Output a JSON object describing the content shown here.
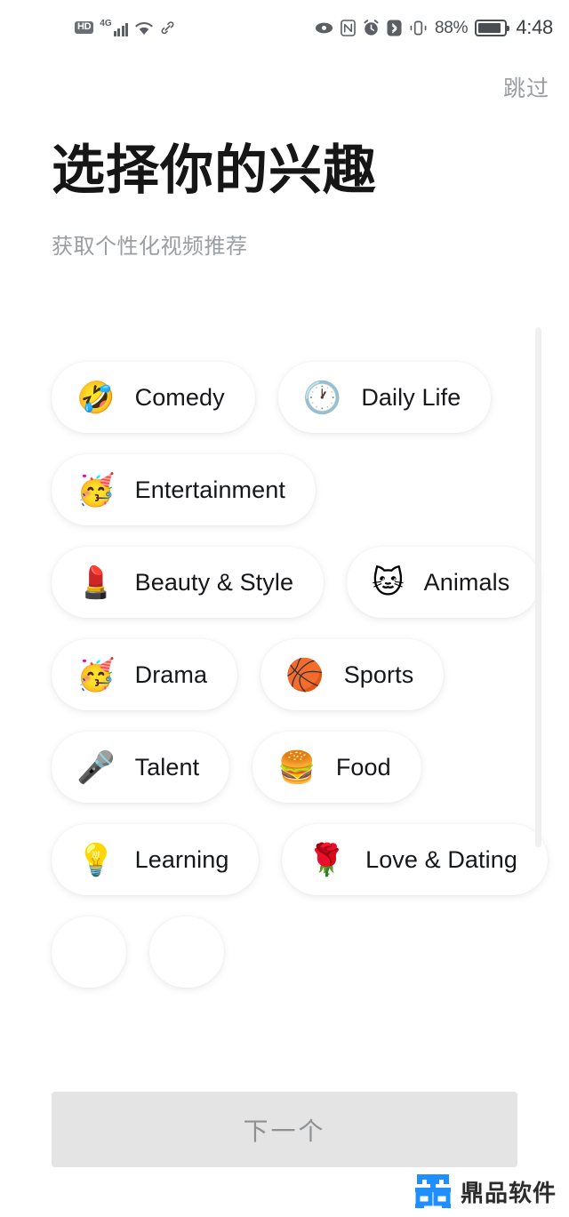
{
  "status_bar": {
    "hd_label": "HD",
    "network_label": "4G",
    "icons": [
      "hd-badge-icon",
      "signal-bars-icon",
      "wifi-icon",
      "link-icon",
      "eye-icon",
      "nfc-icon",
      "alarm-icon",
      "bluetooth-icon",
      "vibrate-icon",
      "battery-icon"
    ],
    "battery_percent": "88%",
    "time": "4:48"
  },
  "header": {
    "skip_label": "跳过",
    "title": "选择你的兴趣",
    "subtitle": "获取个性化视频推荐"
  },
  "interests": {
    "chips": [
      {
        "label": "Comedy",
        "emoji": "🤣",
        "emoji_name": "rolling-on-floor-laughing-emoji"
      },
      {
        "label": "Daily Life",
        "emoji": "🕐",
        "emoji_name": "clock-emoji"
      },
      {
        "label": "Entertainment",
        "emoji": "🥳",
        "emoji_name": "partying-face-emoji"
      },
      {
        "label": "Beauty & Style",
        "emoji": "💄",
        "emoji_name": "lipstick-emoji"
      },
      {
        "label": "Animals",
        "emoji": "🐱",
        "emoji_name": "cat-face-emoji"
      },
      {
        "label": "Drama",
        "emoji": "🥳",
        "emoji_name": "partying-face-emoji"
      },
      {
        "label": "Sports",
        "emoji": "🏀",
        "emoji_name": "basketball-emoji"
      },
      {
        "label": "Talent",
        "emoji": "🎤",
        "emoji_name": "microphone-emoji"
      },
      {
        "label": "Food",
        "emoji": "🍔",
        "emoji_name": "hamburger-emoji"
      },
      {
        "label": "Learning",
        "emoji": "💡",
        "emoji_name": "light-bulb-emoji"
      },
      {
        "label": "Love & Dating",
        "emoji": "🌹",
        "emoji_name": "rose-emoji"
      },
      {
        "label": "",
        "emoji": "",
        "emoji_name": "hidden-emoji"
      },
      {
        "label": "",
        "emoji": "",
        "emoji_name": "hidden-emoji"
      }
    ]
  },
  "footer": {
    "next_label": "下一个",
    "next_enabled": false
  },
  "watermark": {
    "text": "鼎品软件",
    "logo_color": "#1f8fff"
  },
  "colors": {
    "background": "#ffffff",
    "title": "#161616",
    "subtitle": "#9a9da1",
    "chip_text": "#15171a",
    "button_bg": "#e4e4e4",
    "button_text": "#8e9194"
  }
}
